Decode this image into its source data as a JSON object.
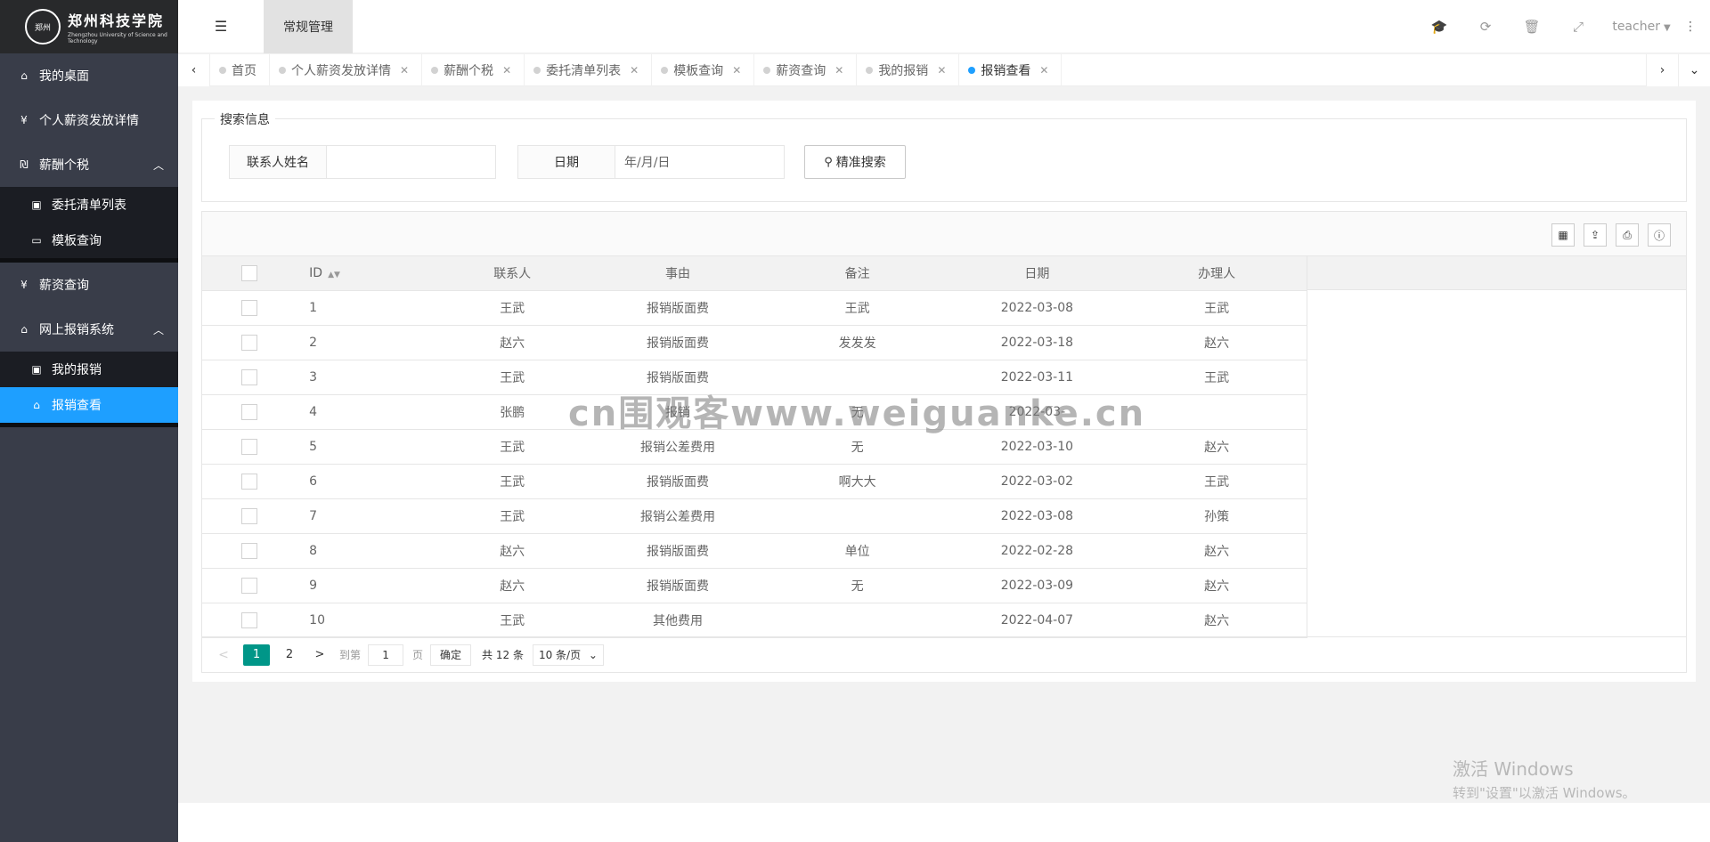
{
  "logo": {
    "seal": "郑州",
    "name_cn": "郑州科技学院",
    "name_en": "Zhengzhou University of Science and Technology"
  },
  "sidebar": {
    "items": [
      {
        "label": "我的桌面",
        "icon": "home-icon"
      },
      {
        "label": "个人薪资发放详情",
        "icon": "yen-icon"
      },
      {
        "label": "薪酬个税",
        "icon": "tax-icon",
        "expanded": true
      },
      {
        "label": "委托清单列表",
        "icon": "money-icon",
        "sub": true
      },
      {
        "label": "模板查询",
        "icon": "window-icon",
        "sub": true
      },
      {
        "label": "薪资查询",
        "icon": "yen-icon"
      },
      {
        "label": "网上报销系统",
        "icon": "home-icon",
        "expanded": true
      },
      {
        "label": "我的报销",
        "icon": "money-icon",
        "sub": true
      },
      {
        "label": "报销查看",
        "icon": "home-icon",
        "sub": true,
        "active": true
      }
    ]
  },
  "header": {
    "menu_tab": "常规管理",
    "username": "teacher"
  },
  "tabs": [
    {
      "label": "首页",
      "closable": false
    },
    {
      "label": "个人薪资发放详情",
      "closable": true
    },
    {
      "label": "薪酬个税",
      "closable": true
    },
    {
      "label": "委托清单列表",
      "closable": true
    },
    {
      "label": "模板查询",
      "closable": true
    },
    {
      "label": "薪资查询",
      "closable": true
    },
    {
      "label": "我的报销",
      "closable": true
    },
    {
      "label": "报销查看",
      "closable": true,
      "active": true
    }
  ],
  "search": {
    "legend": "搜索信息",
    "name_label": "联系人姓名",
    "name_value": "",
    "date_label": "日期",
    "date_placeholder": "年/月/日",
    "button": "精准搜索"
  },
  "table": {
    "columns": [
      "ID",
      "联系人",
      "事由",
      "备注",
      "日期",
      "办理人"
    ],
    "rows": [
      [
        "1",
        "王武",
        "报销版面费",
        "王武",
        "2022-03-08",
        "王武"
      ],
      [
        "2",
        "赵六",
        "报销版面费",
        "发发发",
        "2022-03-18",
        "赵六"
      ],
      [
        "3",
        "王武",
        "报销版面费",
        "",
        "2022-03-11",
        "王武"
      ],
      [
        "4",
        "张鹏",
        "报销",
        "无",
        "2022-03-",
        ""
      ],
      [
        "5",
        "王武",
        "报销公差费用",
        "无",
        "2022-03-10",
        "赵六"
      ],
      [
        "6",
        "王武",
        "报销版面费",
        "啊大大",
        "2022-03-02",
        "王武"
      ],
      [
        "7",
        "王武",
        "报销公差费用",
        "",
        "2022-03-08",
        "孙策"
      ],
      [
        "8",
        "赵六",
        "报销版面费",
        "单位",
        "2022-02-28",
        "赵六"
      ],
      [
        "9",
        "赵六",
        "报销版面费",
        "无",
        "2022-03-09",
        "赵六"
      ],
      [
        "10",
        "王武",
        "其他费用",
        "",
        "2022-04-07",
        "赵六"
      ]
    ]
  },
  "pager": {
    "prev": "<",
    "pages": [
      "1",
      "2"
    ],
    "next": ">",
    "goto_label": "到第",
    "goto_value": "1",
    "page_unit": "页",
    "confirm": "确定",
    "total": "共 12 条",
    "page_size": "10 条/页"
  },
  "watermark": "cn围观客www.weiguanke.cn",
  "windows": {
    "line1": "激活 Windows",
    "line2": "转到\"设置\"以激活 Windows。"
  }
}
